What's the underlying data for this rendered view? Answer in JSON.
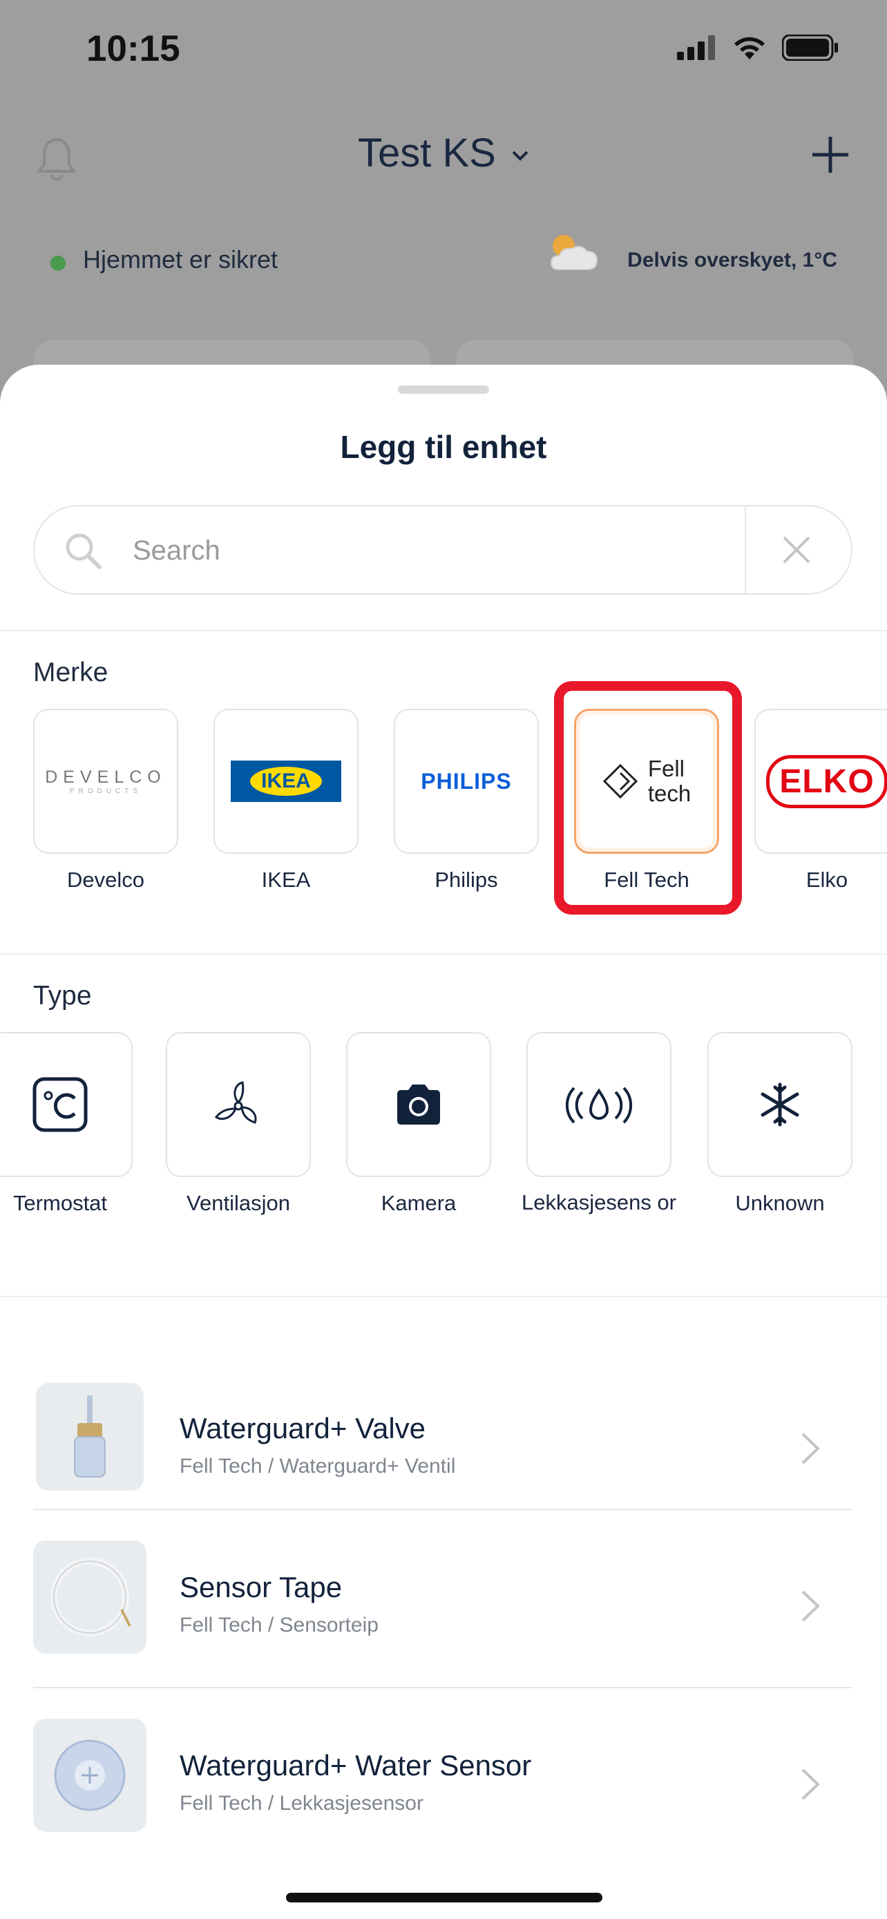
{
  "status_bar": {
    "time": "10:15"
  },
  "header": {
    "home_name": "Test KS",
    "home_status": "Hjemmet er sikret",
    "weather": "Delvis overskyet, 1°C"
  },
  "sheet": {
    "title": "Legg til enhet",
    "search": {
      "placeholder": "Search",
      "value": ""
    },
    "brand_section": "Merke",
    "brands": [
      {
        "label": "Develco",
        "logo_text": "DEVELCO",
        "logo_sub": "PRODUCTS"
      },
      {
        "label": "IKEA",
        "logo_text": "IKEA"
      },
      {
        "label": "Philips",
        "logo_text": "PHILIPS"
      },
      {
        "label": "Fell Tech",
        "logo_text_1": "Fell",
        "logo_text_2": "tech",
        "selected": true
      },
      {
        "label": "Elko",
        "logo_text": "ELKO"
      }
    ],
    "type_section": "Type",
    "types": [
      {
        "label": "Termostat",
        "icon": "thermostat-icon"
      },
      {
        "label": "Ventilasjon",
        "icon": "fan-icon"
      },
      {
        "label": "Kamera",
        "icon": "camera-icon"
      },
      {
        "label": "Lekkasjesens or",
        "icon": "leak-sensor-icon"
      },
      {
        "label": "Unknown",
        "icon": "snowflake-icon"
      }
    ],
    "products": [
      {
        "name": "Waterguard+ Valve",
        "sub": "Fell Tech / Waterguard+ Ventil"
      },
      {
        "name": "Sensor Tape",
        "sub": "Fell Tech / Sensorteip"
      },
      {
        "name": "Waterguard+ Water Sensor",
        "sub": "Fell Tech / Lekkasjesensor"
      }
    ]
  },
  "colors": {
    "highlight": "#e8182a",
    "selected_border": "#f4a36a",
    "ikea_blue": "#0058a3",
    "ikea_yellow": "#ffdb00",
    "philips_blue": "#0b5ed7",
    "elko_red": "#e30613"
  }
}
